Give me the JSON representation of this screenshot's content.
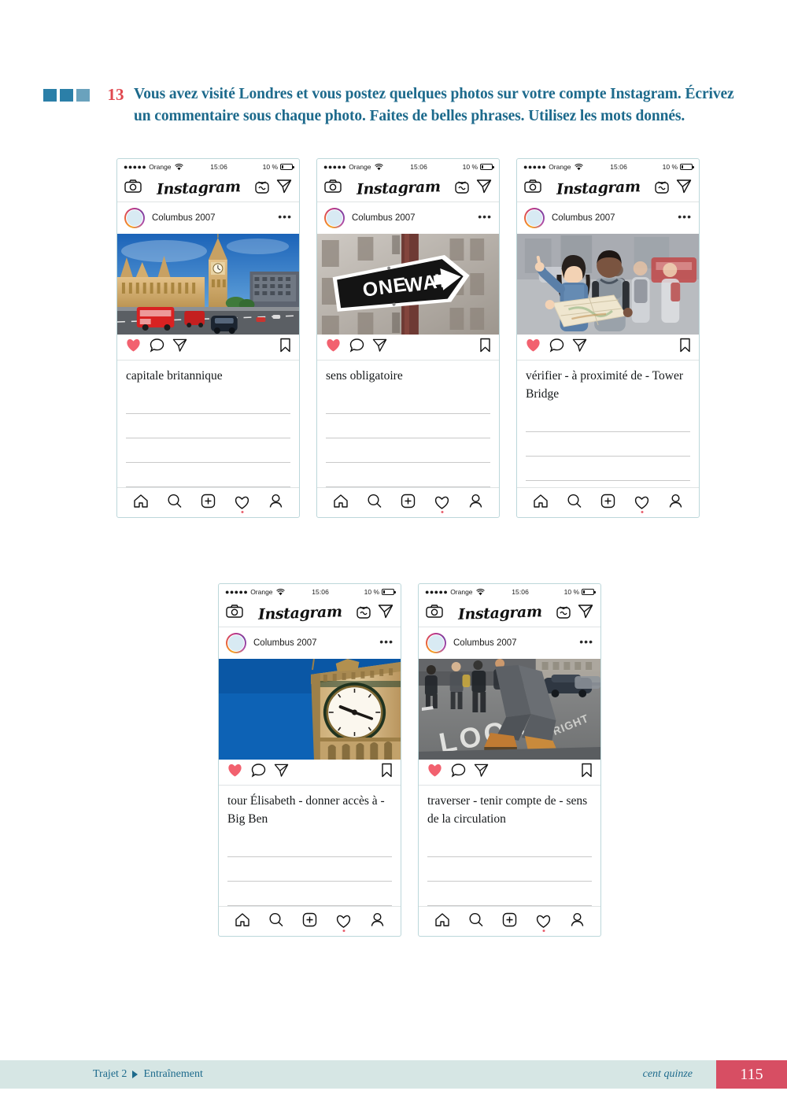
{
  "exercise": {
    "number": "13",
    "level_squares": 3,
    "instruction": "Vous avez visité Londres et vous postez quelques photos sur votre compte Instagram. Écrivez un commentaire sous chaque photo. Faites de belles phrases. Utilisez les mots donnés.",
    "number_color": "#e0484f",
    "text_color": "#1d6a8c",
    "marker_color": "#2b7fa8"
  },
  "phone_common": {
    "status": {
      "signal_dots": "●●●●●",
      "carrier": "Orange",
      "wifi_icon": "wifi-icon",
      "time": "15:06",
      "battery_percent": "10 %",
      "battery_icon": "battery-icon"
    },
    "topbar": {
      "camera_icon": "camera-icon",
      "logo": "Instagram",
      "igtv_icon": "igtv-icon",
      "send_icon": "paper-plane-icon"
    },
    "userrow": {
      "avatar_icon": "avatar",
      "username": "Columbus 2007",
      "menu_icon": "ellipsis-icon"
    },
    "actions": {
      "like_icon": "heart-filled-icon",
      "comment_icon": "comment-bubble-icon",
      "share_icon": "paper-plane-icon",
      "save_icon": "bookmark-icon",
      "like_color": "#f2616f"
    },
    "bottomnav": {
      "home_icon": "home-icon",
      "search_icon": "search-icon",
      "add_icon": "plus-square-icon",
      "activity_icon": "heart-outline-icon",
      "profile_icon": "person-icon",
      "activity_dot_color": "#e8616f"
    }
  },
  "posts": [
    {
      "id": "post-big-ben-westminster",
      "photo_alt": "Big Ben, Houses of Parliament and red double-decker buses on Westminster Bridge",
      "caption": "capitale britannique",
      "write_lines": 4
    },
    {
      "id": "post-one-way-sign",
      "photo_alt": "Black and white ONE WAY street sign with arrow pointing right",
      "caption": "sens obligatoire",
      "write_lines": 4
    },
    {
      "id": "post-tourists-map",
      "photo_alt": "Two tourists holding a map and pointing in a city street",
      "caption": "vérifier - à proximité de - Tower Bridge",
      "write_lines": 3
    },
    {
      "id": "post-big-ben-clock",
      "photo_alt": "Close up of the Big Ben clock face against a blue sky",
      "caption": "tour Élisabeth - donner accès à - Big Ben",
      "write_lines": 3
    },
    {
      "id": "post-look-crossing",
      "photo_alt": "Pedestrian walking over a LOOK marking painted on the road",
      "caption": "traverser - tenir compte de - sens de la circulation",
      "write_lines": 3
    }
  ],
  "footer": {
    "section": "Trajet 2",
    "arrow_icon": "triangle-right-icon",
    "subsection": "Entraînement",
    "page_words": "cent quinze",
    "page_number": "115",
    "bar_color": "#d6e6e4",
    "page_tab_color": "#d74e63"
  }
}
